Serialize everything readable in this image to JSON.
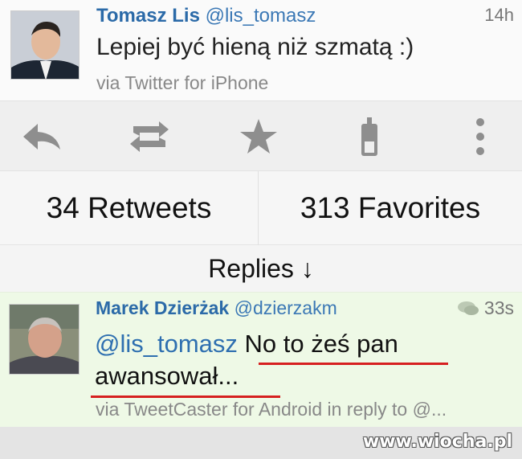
{
  "tweet": {
    "author_name": "Tomasz Lis",
    "author_handle": "@lis_tomasz",
    "time": "14h",
    "text": "Lepiej być hieną niż szmatą :)",
    "via": "via Twitter for iPhone"
  },
  "actions": [
    {
      "icon": "reply-icon"
    },
    {
      "icon": "retweet-icon"
    },
    {
      "icon": "star-icon"
    },
    {
      "icon": "phone-icon"
    },
    {
      "icon": "more-icon"
    }
  ],
  "stats": {
    "retweets": "34 Retweets",
    "favorites": "313 Favorites"
  },
  "replies_label": "Replies ↓",
  "reply": {
    "author_name": "Marek Dzierżak",
    "author_handle": "@dzierzakm",
    "time": "33s",
    "mention": "@lis_tomasz",
    "text_line1": "No to żeś pan",
    "text_line2": "awansował...",
    "via": "via TweetCaster for Android in reply to @..."
  },
  "watermark": "www.wiocha.pl",
  "colors": {
    "name": "#2b6aa8",
    "underline": "#d62020",
    "reply_bg": "#eef9e6"
  }
}
